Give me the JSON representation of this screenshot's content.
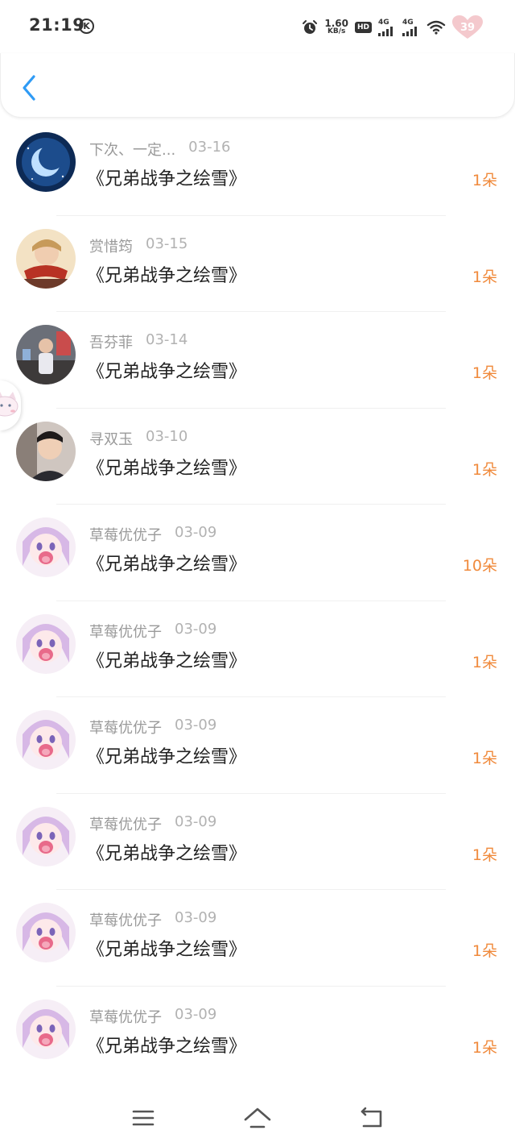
{
  "status_bar": {
    "time": "21:19",
    "k_badge": "K",
    "net_speed_value": "1.60",
    "net_speed_unit": "KB/s",
    "hd_label": "HD",
    "sim1_label": "4G",
    "sim2_label": "4G",
    "battery_level": "39",
    "icons": [
      "alarm-icon",
      "hd-icon",
      "signal-icon",
      "signal-icon",
      "wifi-icon",
      "battery-heart-icon"
    ]
  },
  "header": {
    "back_icon": "chevron-left-icon"
  },
  "records": [
    {
      "name": "下次、一定...",
      "date": "03-16",
      "book": "《兄弟战争之绘雪》",
      "amount": "1朵",
      "avatar": "moon-night"
    },
    {
      "name": "赏惜筠",
      "date": "03-15",
      "book": "《兄弟战争之绘雪》",
      "amount": "1朵",
      "avatar": "person-scarf"
    },
    {
      "name": "吾芬菲",
      "date": "03-14",
      "book": "《兄弟战争之绘雪》",
      "amount": "1朵",
      "avatar": "person-street"
    },
    {
      "name": "寻双玉",
      "date": "03-10",
      "book": "《兄弟战争之绘雪》",
      "amount": "1朵",
      "avatar": "young-man"
    },
    {
      "name": "草莓优优子",
      "date": "03-09",
      "book": "《兄弟战争之绘雪》",
      "amount": "10朵",
      "avatar": "anime-girl"
    },
    {
      "name": "草莓优优子",
      "date": "03-09",
      "book": "《兄弟战争之绘雪》",
      "amount": "1朵",
      "avatar": "anime-girl"
    },
    {
      "name": "草莓优优子",
      "date": "03-09",
      "book": "《兄弟战争之绘雪》",
      "amount": "1朵",
      "avatar": "anime-girl"
    },
    {
      "name": "草莓优优子",
      "date": "03-09",
      "book": "《兄弟战争之绘雪》",
      "amount": "1朵",
      "avatar": "anime-girl"
    },
    {
      "name": "草莓优优子",
      "date": "03-09",
      "book": "《兄弟战争之绘雪》",
      "amount": "1朵",
      "avatar": "anime-girl"
    },
    {
      "name": "草莓优优子",
      "date": "03-09",
      "book": "《兄弟战争之绘雪》",
      "amount": "1朵",
      "avatar": "anime-girl"
    }
  ],
  "colors": {
    "accent_blue": "#2f9bf5",
    "amount_orange": "#f08a3c",
    "name_gray": "#9a9a9a",
    "title_dark": "#222222"
  },
  "navbar": {
    "icons": [
      "menu-icon",
      "home-icon",
      "back-nav-icon"
    ]
  }
}
